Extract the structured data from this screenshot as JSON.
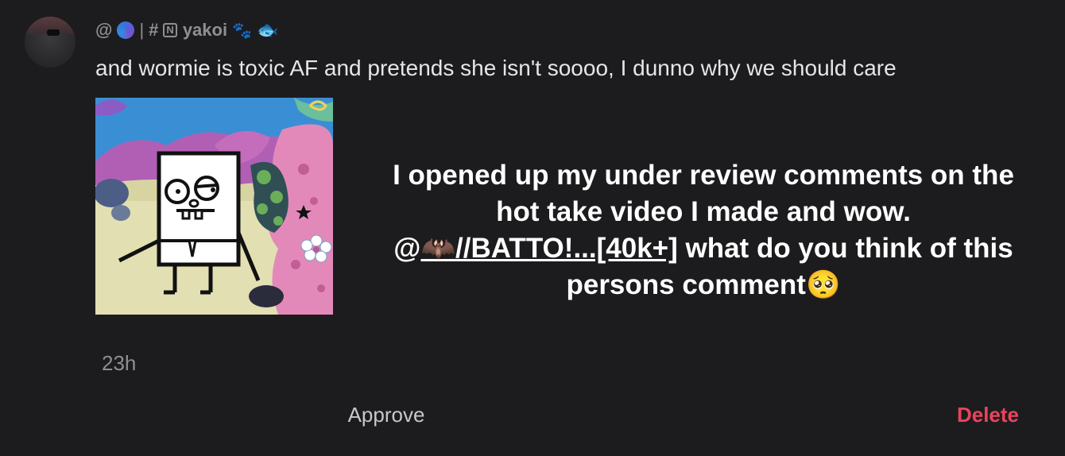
{
  "comment": {
    "username": {
      "at": "@",
      "separator": "|",
      "hash": "#",
      "boxed_letter": "N",
      "name": "yakoi",
      "paw_icon": "🐾",
      "fish_icon": "🐟"
    },
    "text": "and wormie is toxic AF and pretends she isn't soooo, I dunno why we should care",
    "timestamp": "23h"
  },
  "overlay": {
    "line1": "I opened up my under review comments on the",
    "line2": "hot take video I made and wow.",
    "line3_at": "@",
    "line3_bat": "🦇",
    "line3_mention": "//BATTO!...[40k+]",
    "line3_rest": " what do you think of this",
    "line4": "persons comment",
    "line4_emoji": "🥺"
  },
  "actions": {
    "approve_label": "Approve",
    "delete_label": "Delete"
  },
  "colors": {
    "background": "#1c1c1e",
    "delete": "#e8445d",
    "secondary_text": "#8e8e93"
  }
}
